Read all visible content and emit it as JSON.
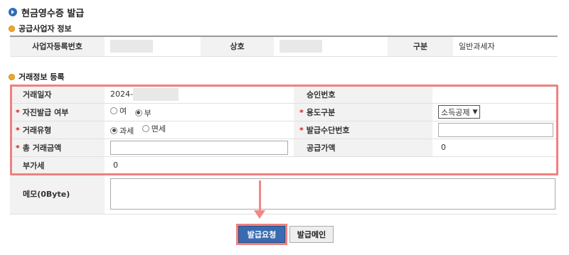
{
  "page": {
    "title": "현금영수증 발급"
  },
  "supplier": {
    "section_title": "공급사업자 정보",
    "biz_no_label": "사업자등록번호",
    "name_label": "상호",
    "type_label": "구분",
    "type_value": "일반과세자"
  },
  "transaction": {
    "section_title": "거래정보 등록",
    "date_label": "거래일자",
    "date_value": "2024-",
    "approval_label": "승인번호",
    "self_issue_label": "자진발급 여부",
    "self_issue_options": [
      "여",
      "부"
    ],
    "self_issue_selected": "부",
    "purpose_label": "용도구분",
    "purpose_value": "소득공제",
    "tx_type_label": "거래유형",
    "tx_type_options": [
      "과세",
      "면세"
    ],
    "tx_type_selected": "과세",
    "means_label": "발급수단번호",
    "total_label": "총 거래금액",
    "supply_label": "공급가액",
    "supply_value": "0",
    "vat_label": "부가세",
    "vat_value": "0",
    "memo_label": "메모(0Byte)",
    "required_mark": "*"
  },
  "buttons": {
    "request": "발급요청",
    "cancel": "발급메인"
  },
  "colors": {
    "accent": "#3a6bb0",
    "highlight": "#f08080",
    "required": "#d02020"
  }
}
